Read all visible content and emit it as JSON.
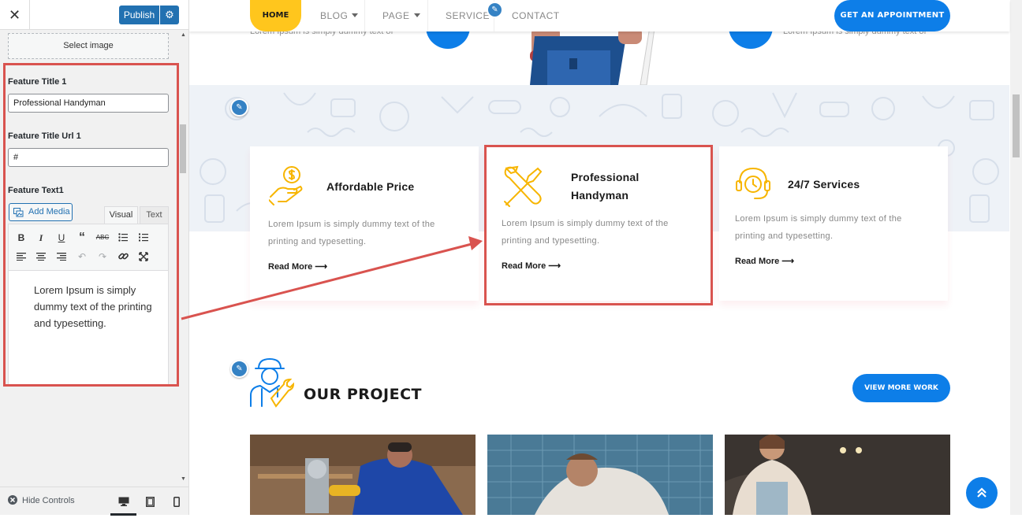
{
  "customizer": {
    "close_icon": "close-icon",
    "publish_label": "Publish",
    "select_image_label": "Select image",
    "field1_label": "Feature Title 1",
    "field1_value": "Professional Handyman",
    "field2_label": "Feature Title Url 1",
    "field2_value": "#",
    "field3_label": "Feature Text1",
    "add_media_label": "Add Media",
    "tab_visual": "Visual",
    "tab_text": "Text",
    "editor_text": "Lorem Ipsum is simply dummy text of the printing and typesetting.",
    "hide_controls_label": "Hide Controls"
  },
  "nav": {
    "home": "HOME",
    "blog": "BLOG",
    "page": "PAGE",
    "service": "SERVICE",
    "contact": "CONTACT",
    "cta": "GET AN APPOINTMENT"
  },
  "hero": {
    "left_text": "Lorem Ipsum is simply dummy text of",
    "right_text": "Lorem Ipsum is simply dummy text of"
  },
  "features": [
    {
      "title": "Affordable Price",
      "text": "Lorem Ipsum is simply dummy text of the printing and typesetting.",
      "link": "Read More ⟶"
    },
    {
      "title": "Professional Handyman",
      "text": "Lorem Ipsum is simply dummy text of the printing and typesetting.",
      "link": "Read More ⟶"
    },
    {
      "title": "24/7 Services",
      "text": "Lorem Ipsum is simply dummy text of the printing and typesetting.",
      "link": "Read More ⟶"
    }
  ],
  "project": {
    "title": "OUR PROJECT",
    "view_more": "VIEW MORE WORK"
  },
  "colors": {
    "accent_blue": "#0d7ee8",
    "accent_yellow": "#ffc61d",
    "highlight_red": "#d9534f",
    "wp_blue": "#2271b1"
  }
}
